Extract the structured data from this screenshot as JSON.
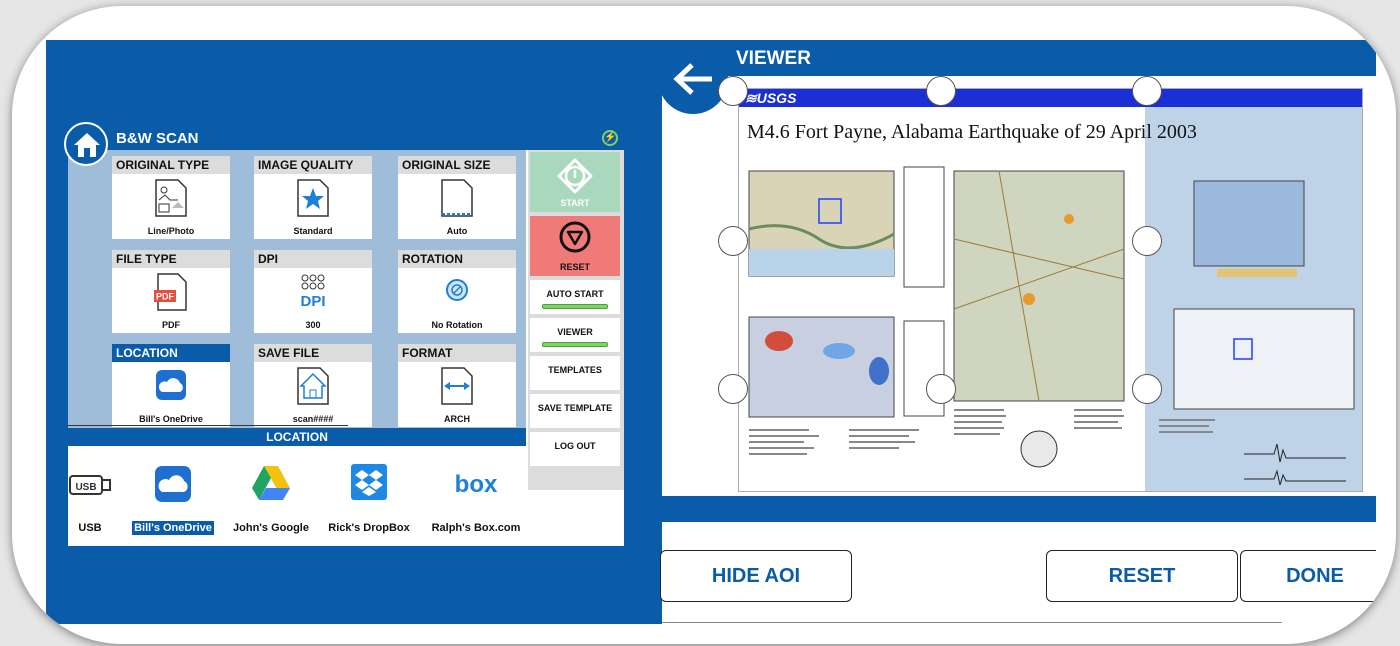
{
  "scan_panel": {
    "title": "B&W SCAN",
    "tiles": [
      {
        "label": "ORIGINAL TYPE",
        "value": "Line/Photo",
        "icon": "line-photo-icon"
      },
      {
        "label": "IMAGE QUALITY",
        "value": "Standard",
        "icon": "star-icon"
      },
      {
        "label": "ORIGINAL SIZE",
        "value": "Auto",
        "icon": "page-size-icon"
      },
      {
        "label": "FILE TYPE",
        "value": "PDF",
        "icon": "pdf-file-icon",
        "icon_text": "PDF"
      },
      {
        "label": "DPI",
        "value": "300",
        "icon": "dpi-icon",
        "icon_text": "DPI"
      },
      {
        "label": "ROTATION",
        "value": "No Rotation",
        "icon": "rotation-icon"
      },
      {
        "label": "LOCATION",
        "value": "Bill's OneDrive",
        "icon": "onedrive-icon"
      },
      {
        "label": "SAVE FILE",
        "value": "scan####",
        "icon": "save-file-icon"
      },
      {
        "label": "FORMAT",
        "value": "ARCH",
        "icon": "format-arrows-icon"
      }
    ],
    "actions": {
      "start": "START",
      "reset": "RESET",
      "auto_start": "AUTO START",
      "viewer": "VIEWER",
      "templates": "TEMPLATES",
      "save_template": "SAVE TEMPLATE",
      "log_out": "LOG OUT"
    },
    "location_bar": "LOCATION",
    "locations": [
      {
        "name": "USB",
        "icon": "usb-icon",
        "icon_text": "USB"
      },
      {
        "name": "Bill's OneDrive",
        "icon": "onedrive-icon",
        "selected": true
      },
      {
        "name": "John's Google",
        "icon": "google-drive-icon"
      },
      {
        "name": "Rick's DropBox",
        "icon": "dropbox-icon"
      },
      {
        "name": "Ralph's Box.com",
        "icon": "box-icon",
        "icon_text": "box"
      }
    ],
    "colors": {
      "brand_blue": "#0a5ca8",
      "start_green": "#aad8bd",
      "reset_red": "#f07a78",
      "eco_green": "#7cd164"
    }
  },
  "viewer": {
    "title": "VIEWER",
    "doc_brand": "≋USGS",
    "doc_title": "M4.6 Fort Payne, Alabama Earthquake of 29 April 2003",
    "buttons": {
      "hide_aoi": "HIDE AOI",
      "reset": "RESET",
      "done": "DONE"
    }
  }
}
